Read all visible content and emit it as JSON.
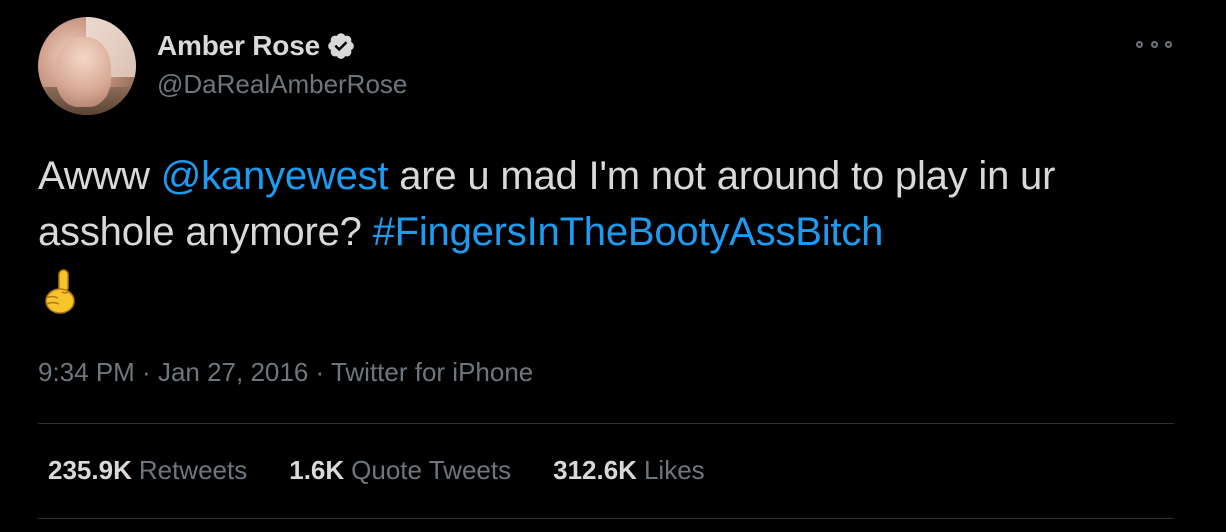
{
  "author": {
    "display_name": "Amber Rose",
    "handle": "@DaRealAmberRose",
    "verified_icon": "verified-badge-icon",
    "avatar": "profile-photo"
  },
  "more_icon": "more-options-icon",
  "tweet": {
    "text_part1": "Awww ",
    "mention": "@kanyewest",
    "text_part2": " are u mad I'm not around to play in ur asshole anymore? ",
    "hashtag": "#FingersInTheBootyAssBitch",
    "emoji": "☝"
  },
  "meta": {
    "time": "9:34 PM",
    "separator1": " · ",
    "date": "Jan 27, 2016",
    "separator2": " · ",
    "source": "Twitter for iPhone"
  },
  "stats": {
    "retweets_count": "235.9K",
    "retweets_label": "Retweets",
    "quote_count": "1.6K",
    "quote_label": "Quote Tweets",
    "likes_count": "312.6K",
    "likes_label": "Likes"
  },
  "colors": {
    "background": "#000000",
    "text": "#d9d9d9",
    "secondary": "#6e767d",
    "link": "#1d9bf0",
    "divider": "#2f3336"
  }
}
